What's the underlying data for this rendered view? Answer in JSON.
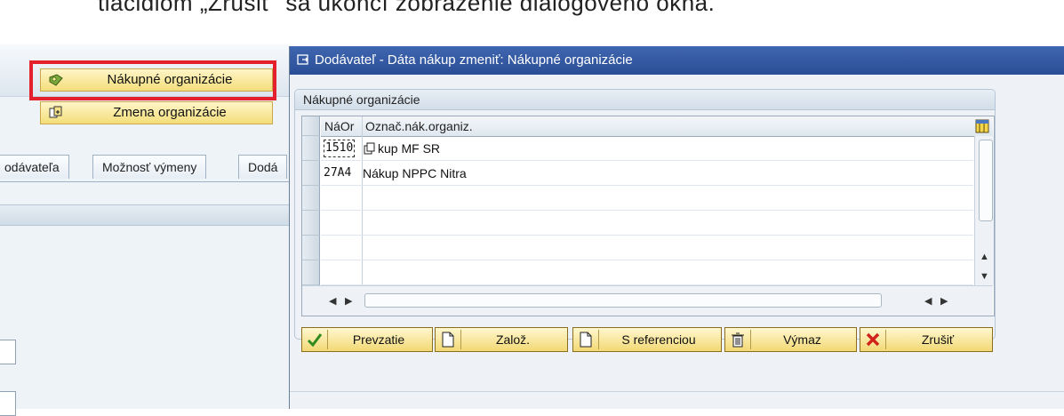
{
  "caption": "tlačidlom „Zrušiť“ sa ukončí zobrazenie dialógového okna.",
  "menu": {
    "items": [
      {
        "label": "Nákupné organizácie"
      },
      {
        "label": "Zmena organizácie"
      }
    ]
  },
  "background_tabs": [
    {
      "label": "odávateľa"
    },
    {
      "label": "Možnosť výmeny"
    },
    {
      "label": "Dodá"
    }
  ],
  "dialog": {
    "title": "Dodávateľ - Dáta nákup zmeniť: Nákupné organizácie",
    "group_title": "Nákupné organizácie",
    "table": {
      "columns": [
        "NáOr",
        "Označ.nák.organiz."
      ],
      "rows": [
        {
          "code": "1510",
          "name": "kup MF SR"
        },
        {
          "code": "27A4",
          "name": "Nákup NPPC Nitra"
        }
      ]
    },
    "buttons": {
      "accept": "Prevzatie",
      "create": "Založ.",
      "with_reference": "S referenciou",
      "delete": "Výmaz",
      "cancel": "Zrušiť"
    }
  },
  "colors": {
    "title_bar": "#2b4e96",
    "highlight_border": "#e3202b",
    "button_fill": "#f2d874"
  }
}
